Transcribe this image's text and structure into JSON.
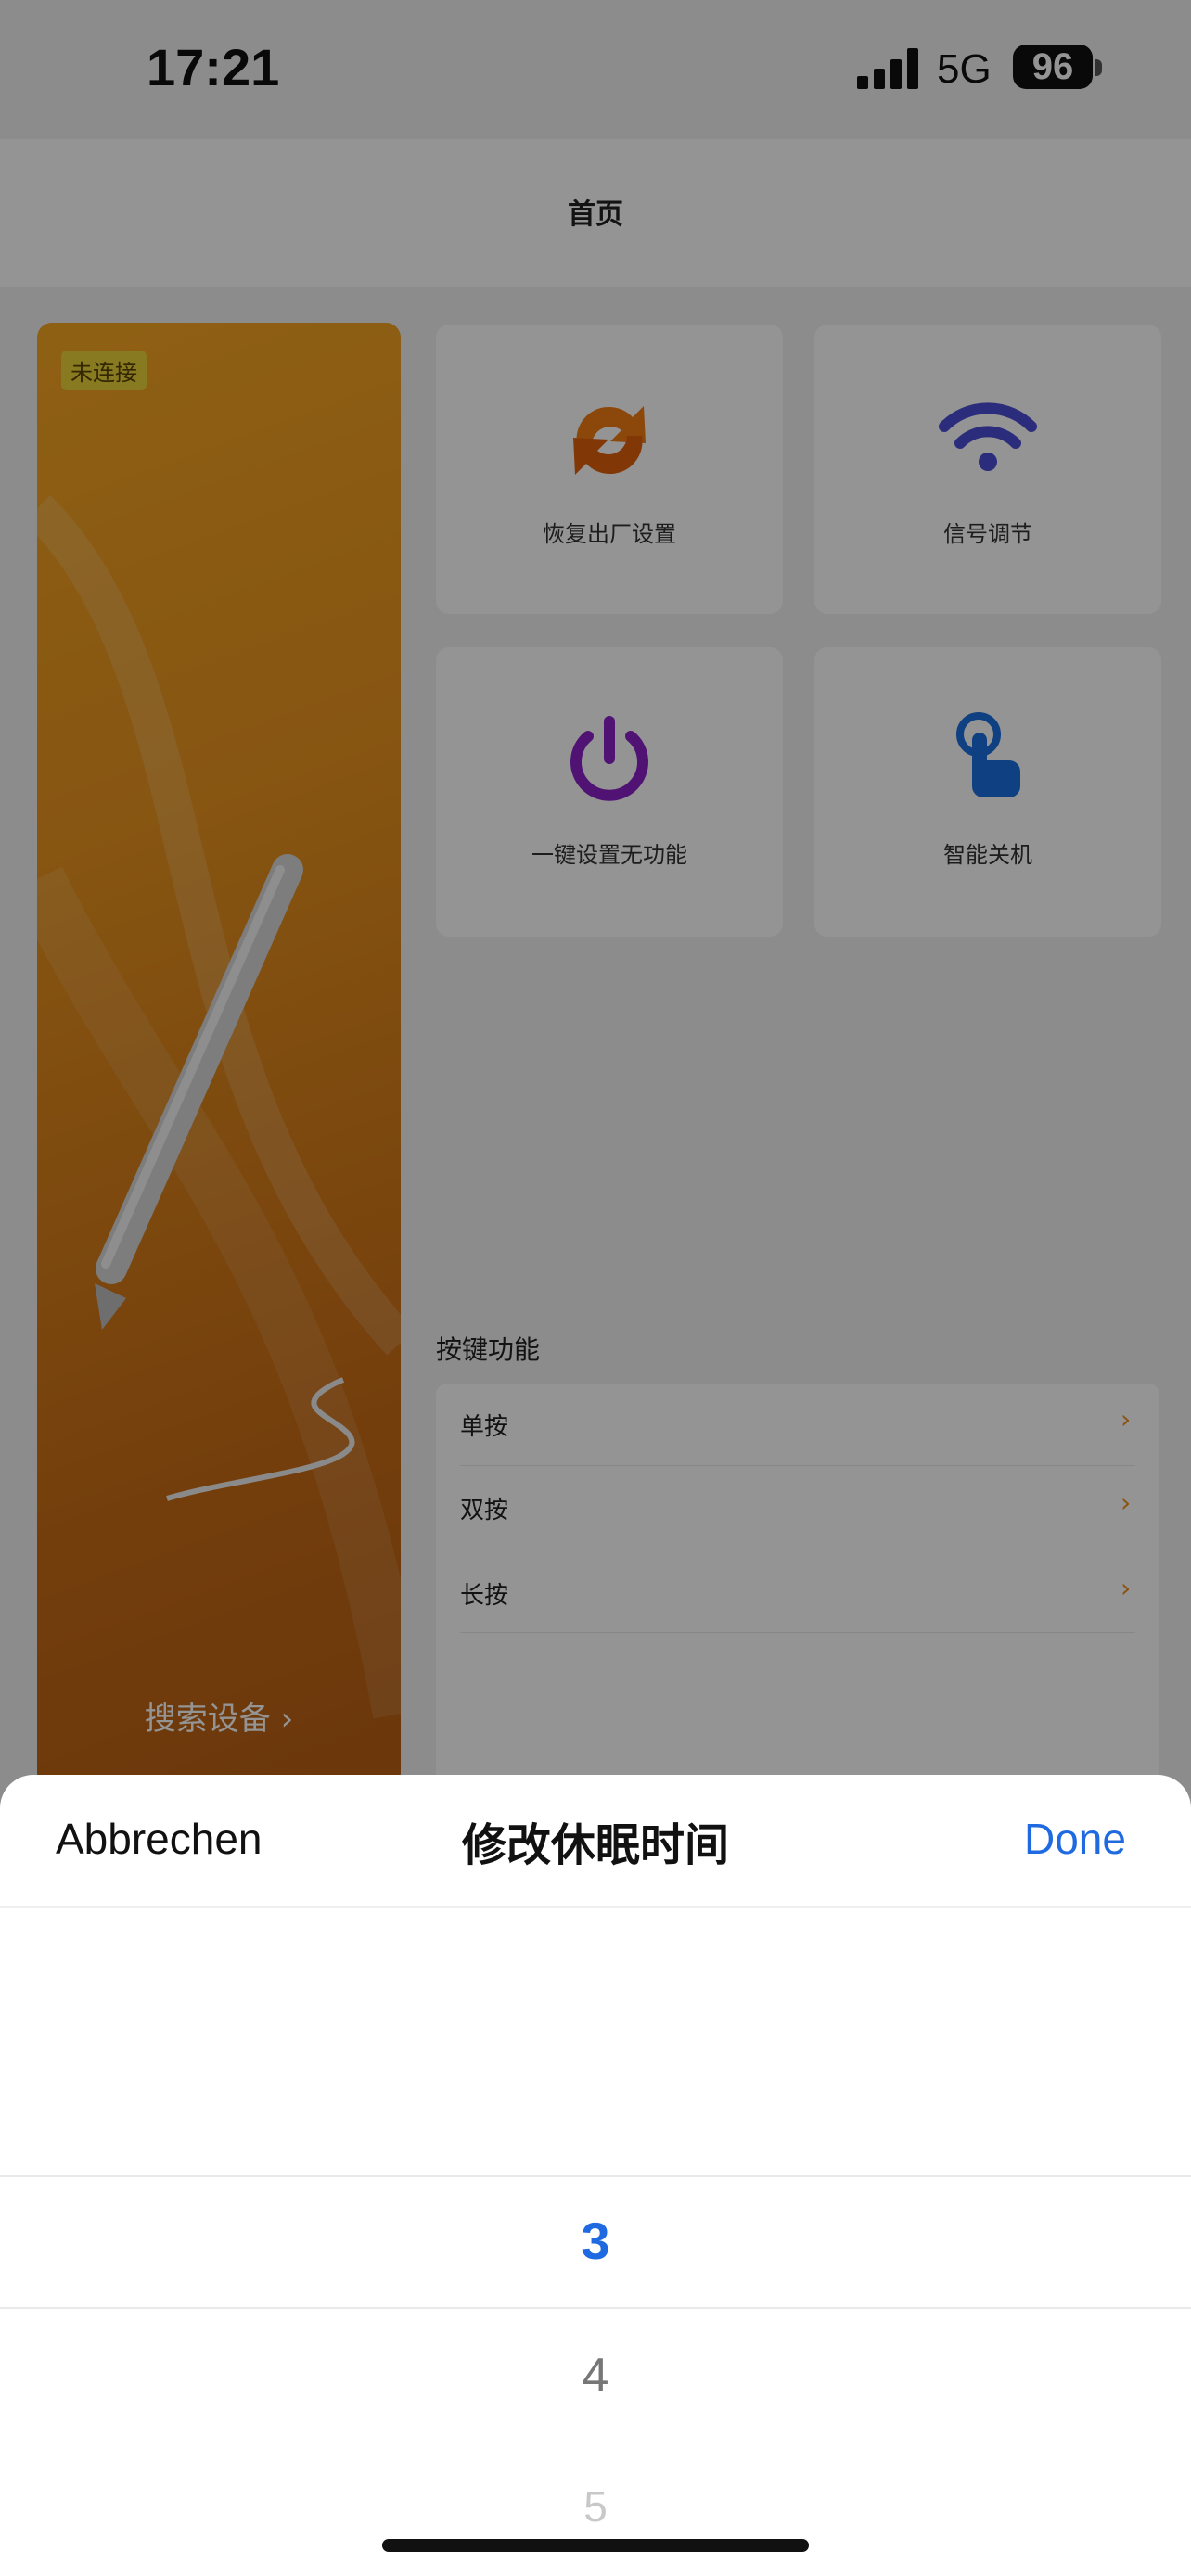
{
  "status_bar": {
    "time": "17:21",
    "network": "5G",
    "battery": "96"
  },
  "nav": {
    "title": "首页"
  },
  "device_card": {
    "status_badge": "未连接",
    "search_label": "搜索设备 ›"
  },
  "tiles": [
    {
      "label": "恢复出厂设置",
      "icon": "refresh-arrows-icon"
    },
    {
      "label": "信号调节",
      "icon": "wifi-icon"
    },
    {
      "label": "一键设置无功能",
      "icon": "power-icon"
    },
    {
      "label": "智能关机",
      "icon": "touch-hand-icon"
    }
  ],
  "key_functions": {
    "title": "按键功能",
    "items": [
      {
        "label": "单按"
      },
      {
        "label": "双按"
      },
      {
        "label": "长按"
      }
    ],
    "chevron": "›"
  },
  "sheet": {
    "cancel_label": "Abbrechen",
    "title": "修改休眠时间",
    "done_label": "Done",
    "picker": {
      "selected": "3",
      "next": "4",
      "next2": "5"
    }
  },
  "colors": {
    "accent": "#f5a623",
    "done_blue": "#1f6ae0"
  }
}
